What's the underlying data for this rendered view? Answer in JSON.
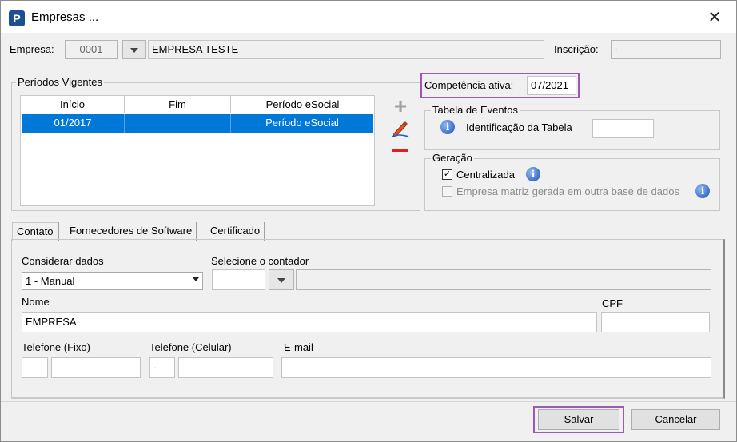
{
  "window": {
    "title": "Empresas ...",
    "icon_letter": "P",
    "close_glyph": "✕"
  },
  "empresa": {
    "label": "Empresa:",
    "code": "0001",
    "name": "EMPRESA TESTE",
    "inscricao_label": "Inscrição:",
    "inscricao_value": "·"
  },
  "periodos": {
    "group_label": "Períodos Vigentes",
    "columns": [
      "Início",
      "Fim",
      "Período eSocial"
    ],
    "rows": [
      {
        "inicio": "01/2017",
        "fim": "",
        "periodo": "Período eSocial"
      }
    ],
    "actions": {
      "add": "+",
      "remove": "−"
    }
  },
  "competencia": {
    "label": "Competência ativa:",
    "value": "07/2021"
  },
  "tabela_eventos": {
    "group_label": "Tabela de Eventos",
    "identificacao_label": "Identificação da Tabela",
    "identificacao_value": ""
  },
  "geracao": {
    "group_label": "Geração",
    "centralizada_label": "Centralizada",
    "centralizada_checked": "✓",
    "matriz_label": "Empresa matriz gerada em outra base de dados"
  },
  "tabs": [
    "Contato",
    "Fornecedores de Software",
    "Certificado"
  ],
  "contato": {
    "considerar_label": "Considerar dados",
    "considerar_value": "1 - Manual",
    "contador_label": "Selecione o contador",
    "nome_label": "Nome",
    "nome_value": "EMPRESA",
    "cpf_label": "CPF",
    "tel_fixo_label": "Telefone (Fixo)",
    "tel_cel_label": "Telefone (Celular)",
    "tel_cel_ddd": "·",
    "email_label": "E-mail"
  },
  "buttons": {
    "salvar": "Salvar",
    "cancelar": "Cancelar"
  },
  "colors": {
    "selection": "#0078d7",
    "highlight": "#9b59b6",
    "remove": "#e02020",
    "add": "#a0a0a0"
  }
}
